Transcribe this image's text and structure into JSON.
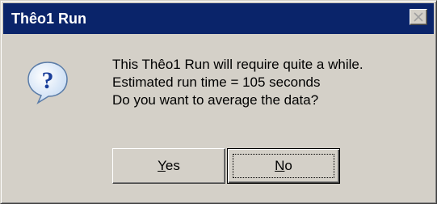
{
  "window": {
    "title": "Thêo1 Run",
    "close_icon": "close-icon"
  },
  "dialog": {
    "icon": "question-icon",
    "message_lines": [
      "This Thêo1 Run will require quite a while.",
      "Estimated run time = 105 seconds",
      "Do you want to average the data?"
    ]
  },
  "buttons": {
    "yes": {
      "mnemonic": "Y",
      "rest": "es"
    },
    "no": {
      "mnemonic": "N",
      "rest": "o"
    }
  }
}
